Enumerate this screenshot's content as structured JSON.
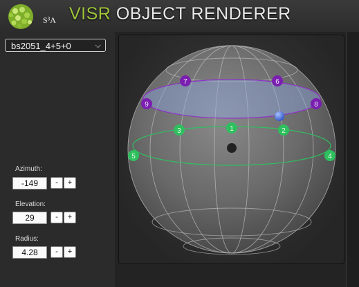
{
  "header": {
    "logo_text": "S³A",
    "title_accent": "VISR",
    "title_rest": "OBJECT RENDERER"
  },
  "scene": {
    "selected": "bs2051_4+5+0"
  },
  "controls": {
    "azimuth": {
      "label": "Azimuth:",
      "value": "-149",
      "minus": "-",
      "plus": "+"
    },
    "elevation": {
      "label": "Elevation:",
      "value": "29",
      "minus": "-",
      "plus": "+"
    },
    "radius": {
      "label": "Radius:",
      "value": "4.28",
      "minus": "-",
      "plus": "+"
    }
  },
  "speakers": {
    "s1": "1",
    "s2": "2",
    "s3": "3",
    "s4": "4",
    "s5": "5",
    "s6": "6",
    "s7": "7",
    "s8": "8",
    "s9": "9"
  },
  "colors": {
    "accent": "#9ec43a",
    "mid_layer": "#2fbf5f",
    "upper_layer": "#7a1fb0",
    "object": "#5a84e6"
  }
}
